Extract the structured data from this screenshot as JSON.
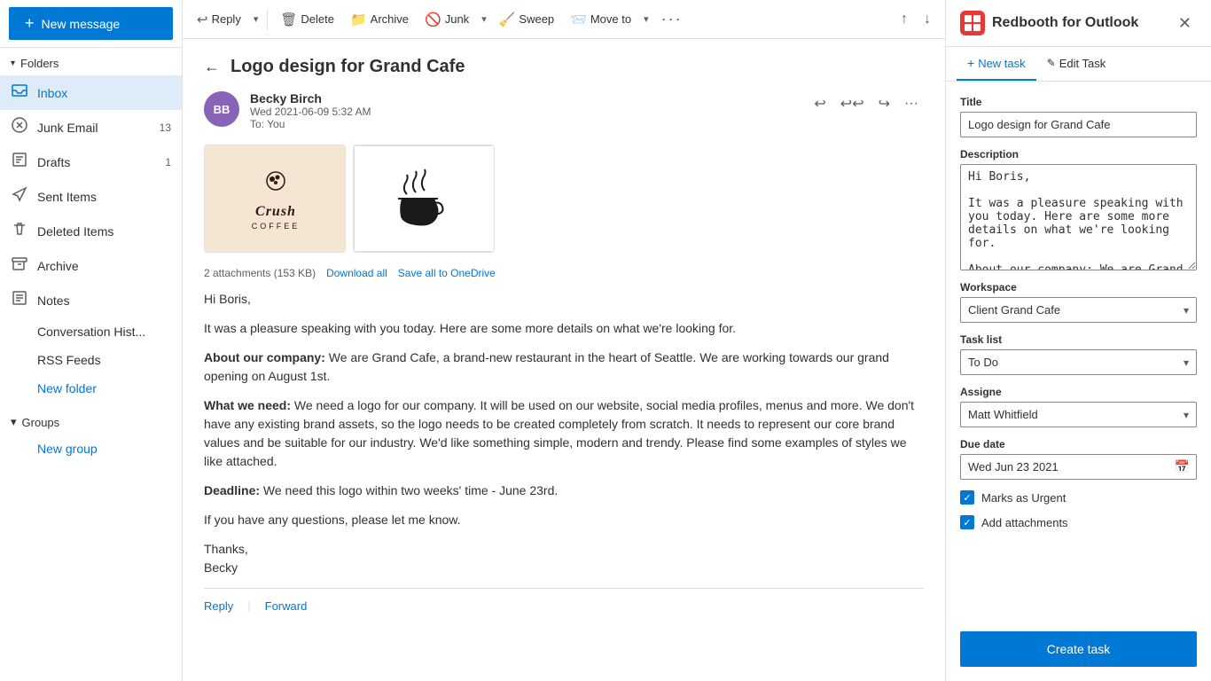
{
  "sidebar": {
    "new_message": "New message",
    "folders_label": "Folders",
    "nav_items": [
      {
        "id": "inbox",
        "label": "Inbox",
        "icon": "📥",
        "badge": "",
        "active": true
      },
      {
        "id": "junk",
        "label": "Junk Email",
        "icon": "🚫",
        "badge": "13",
        "active": false
      },
      {
        "id": "drafts",
        "label": "Drafts",
        "icon": "✏️",
        "badge": "1",
        "active": false
      },
      {
        "id": "sent",
        "label": "Sent Items",
        "icon": "📤",
        "badge": "",
        "active": false
      },
      {
        "id": "deleted",
        "label": "Deleted Items",
        "icon": "🗑️",
        "badge": "",
        "active": false
      },
      {
        "id": "archive",
        "label": "Archive",
        "icon": "📁",
        "badge": "",
        "active": false
      },
      {
        "id": "notes",
        "label": "Notes",
        "icon": "📝",
        "badge": "",
        "active": false
      }
    ],
    "sub_items": [
      {
        "id": "conv-hist",
        "label": "Conversation Hist...",
        "link": false
      },
      {
        "id": "rss",
        "label": "RSS Feeds",
        "link": false
      },
      {
        "id": "new-folder",
        "label": "New folder",
        "link": true
      }
    ],
    "groups_label": "Groups",
    "new_group": "New group"
  },
  "toolbar": {
    "reply": "Reply",
    "delete": "Delete",
    "archive": "Archive",
    "junk": "Junk",
    "sweep": "Sweep",
    "move_to": "Move to"
  },
  "email": {
    "subject": "Logo design for Grand Cafe",
    "sender_initials": "BB",
    "sender_name": "Becky Birch",
    "sender_date": "Wed 2021-06-09 5:32 AM",
    "to": "To:  You",
    "attachments_count": "2 attachments (153 KB)",
    "download_all": "Download all",
    "save_to_onedrive": "Save all to OneDrive",
    "body": [
      {
        "type": "plain",
        "text": "Hi Boris,"
      },
      {
        "type": "plain",
        "text": "It was a pleasure speaking with you today. Here are some more details on what we're looking for."
      },
      {
        "type": "bold_intro",
        "bold": "About our company:",
        "text": " We are Grand Cafe, a brand-new restaurant in the heart of Seattle. We are working towards our grand opening on August 1st."
      },
      {
        "type": "bold_intro",
        "bold": "What we need:",
        "text": " We need a logo for our company. It will be used on our website, social media profiles, menus and more. We don't have any existing brand assets, so the logo needs to be created completely from scratch. It needs to represent our core brand values and be suitable for our industry. We'd like something simple, modern and trendy. Please find some examples of styles we like attached."
      },
      {
        "type": "bold_intro",
        "bold": "Deadline:",
        "text": " We need this logo within two weeks' time - June 23rd."
      },
      {
        "type": "plain",
        "text": "If you have any questions, please let me know."
      },
      {
        "type": "plain",
        "text": "Thanks,\nBecky"
      }
    ],
    "reply_label": "Reply",
    "forward_label": "Forward"
  },
  "redbooth": {
    "title": "Redbooth for Outlook",
    "tab_new": "New task",
    "tab_edit": "Edit Task",
    "form": {
      "title_label": "Title",
      "title_value": "Logo design for Grand Cafe",
      "description_label": "Description",
      "description_value": "Hi Boris,\n\nIt was a pleasure speaking with you today. Here are some more details on what we're looking for.\n\nAbout our company: We are Grand Cafe, a brand-new restaurant in the heart of",
      "workspace_label": "Workspace",
      "workspace_value": "Client Grand Cafe",
      "task_list_label": "Task list",
      "task_list_value": "To Do",
      "assignee_label": "Assigne",
      "assignee_value": "Matt Whitfield",
      "due_date_label": "Due date",
      "due_date_value": "Wed Jun 23 2021",
      "marks_urgent_label": "Marks as Urgent",
      "marks_urgent_checked": true,
      "add_attachments_label": "Add attachments",
      "add_attachments_checked": true,
      "create_task_label": "Create task"
    }
  }
}
